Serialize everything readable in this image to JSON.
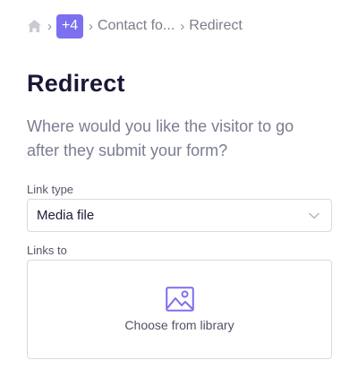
{
  "breadcrumb": {
    "home_icon": "home-icon",
    "separator": "›",
    "more_label": "+4",
    "parent_label": "Contact fo...",
    "current_label": "Redirect"
  },
  "page": {
    "title": "Redirect",
    "description": "Where would you like the visitor to go after they submit your form?"
  },
  "link_type": {
    "label": "Link type",
    "selected_value": "Media file",
    "icon": "chevron-down-icon"
  },
  "links_to": {
    "label": "Links to",
    "action_label": "Choose from library",
    "icon": "image-icon"
  },
  "colors": {
    "accent": "#7c6ff0",
    "title": "#1a1838",
    "muted_text": "#7a7d92",
    "border": "#d8dae0"
  }
}
